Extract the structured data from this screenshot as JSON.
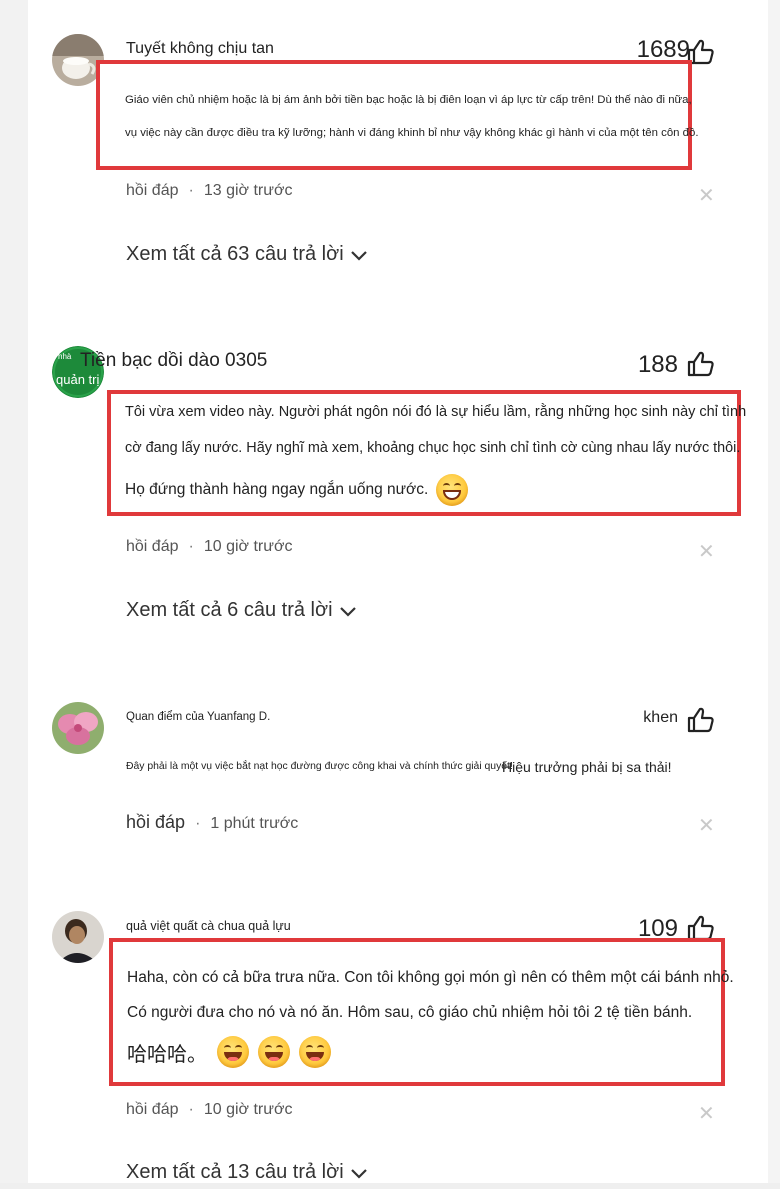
{
  "accent_color": "#e0393b",
  "comments": [
    {
      "username": "Tuyết không chịu tan",
      "likes": "1689",
      "lines": [
        "Giáo viên chủ nhiệm hoặc là bị ám ảnh bởi tiền bạc hoặc là bị điên loạn vì áp lực từ cấp trên! Dù thế nào đi nữa,",
        "vụ việc này cần được điều tra kỹ lưỡng; hành vi đáng khinh bỉ như vậy không khác gì hành vi của một tên côn đồ."
      ],
      "reply": "hồi đáp",
      "time": "13 giờ trước",
      "see_all": "Xem tất cả 63 câu trả lời"
    },
    {
      "username": "Tiền bạc dồi dào 0305",
      "avatar_badge_small": "nhà",
      "avatar_badge": "quản trị",
      "likes": "188",
      "lines": [
        "Tôi vừa xem video này. Người phát ngôn nói đó là sự hiểu lầm, rằng những học sinh này chỉ tình",
        "cờ đang lấy nước. Hãy nghĩ mà xem, khoảng chục học sinh chỉ tình cờ cùng nhau lấy nước thôi.",
        "Họ đứng thành hàng ngay ngắn uống nước."
      ],
      "reply": "hồi đáp",
      "time": "10 giờ trước",
      "see_all": "Xem tất cả 6 câu trả lời"
    },
    {
      "username": "Quan điểm của Yuanfang D.",
      "likes": "khen",
      "text_small": "Đây phải là một vụ việc bắt nạt học đường được công khai và chính thức giải quyết!",
      "text_big": "Hiệu trưởng phải bị sa thải!",
      "reply": "hồi đáp",
      "time": "1 phút trước"
    },
    {
      "username": "quả việt quất cà chua quả lựu",
      "likes": "109",
      "lines": [
        "Haha, còn có cả bữa trưa nữa. Con tôi không gọi món gì nên có thêm một cái bánh nhỏ.",
        "Có người đưa cho nó và nó ăn. Hôm sau, cô giáo chủ nhiệm hỏi tôi 2 tệ tiền bánh.",
        "哈哈哈。"
      ],
      "reply": "hồi đáp",
      "time": "10 giờ trước",
      "see_all": "Xem tất cả 13 câu trả lời"
    }
  ],
  "icons": {
    "like": "thumbs-up-icon",
    "close": "close-icon",
    "expand": "chevron-down-icon",
    "emoji": "grinning-face-icon"
  }
}
